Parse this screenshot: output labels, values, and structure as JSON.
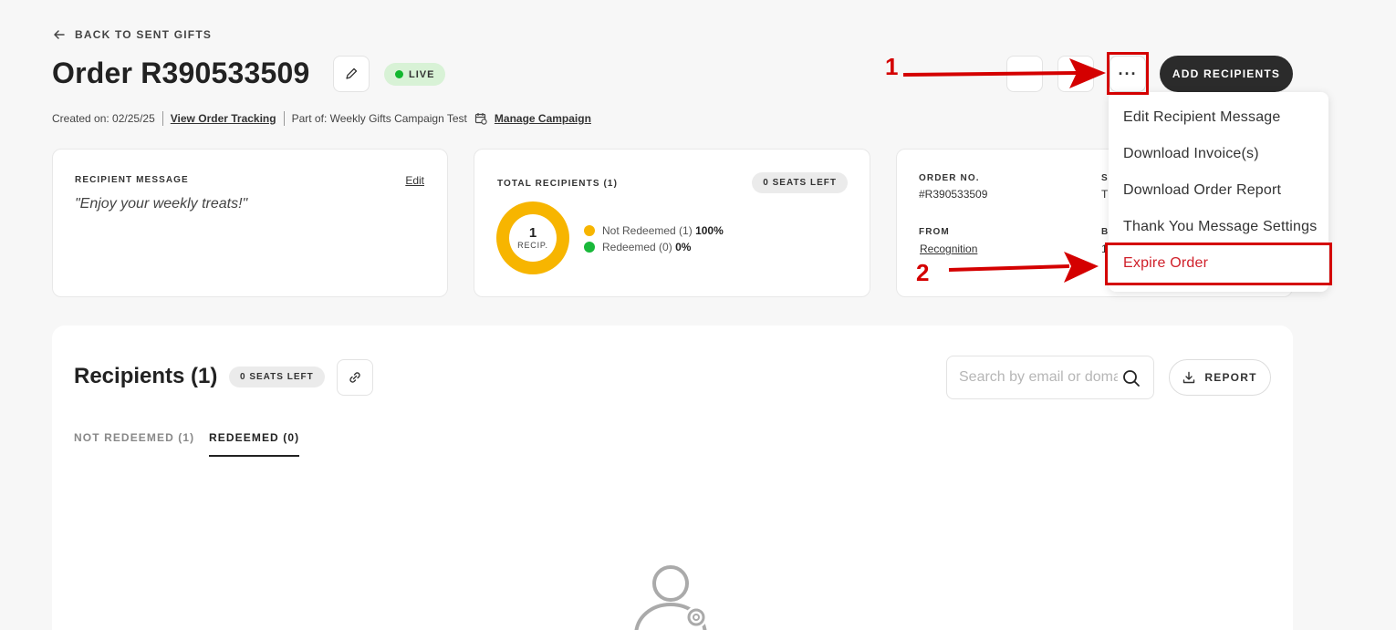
{
  "nav": {
    "back_label": "BACK TO SENT GIFTS"
  },
  "header": {
    "title": "Order R390533509",
    "status": "LIVE",
    "add_label": "ADD RECIPIENTS",
    "more_label": "···"
  },
  "meta": {
    "created": "Created on: 02/25/25",
    "tracking_link": "View Order Tracking",
    "part_of": "Part of: Weekly Gifts Campaign Test",
    "campaign_link": "Manage Campaign"
  },
  "message_card": {
    "label": "RECIPIENT MESSAGE",
    "edit": "Edit",
    "message": "\"Enjoy your weekly treats!\""
  },
  "recipients_card": {
    "label": "TOTAL RECIPIENTS (1)",
    "seats": "0 SEATS LEFT",
    "count": "1",
    "count_label": "RECIP.",
    "legend": [
      {
        "label": "Not Redeemed (1)",
        "pct": "100%",
        "color": "#f7b500"
      },
      {
        "label": "Redeemed (0)",
        "pct": "0%",
        "color": "#19b83a"
      }
    ]
  },
  "order_card": {
    "order_label": "ORDER NO.",
    "order_value": "#R390533509",
    "from_label": "FROM",
    "from_value": "Recognition",
    "col2_label_top": "S",
    "col2_value_top": "T",
    "col2_label_bottom": "B",
    "col2_value_bottom": "1"
  },
  "recipients": {
    "title": "Recipients (1)",
    "seats": "0 SEATS LEFT",
    "search_placeholder": "Search by email or domain",
    "report_label": "REPORT",
    "tabs": [
      "NOT REDEEMED (1)",
      "REDEEMED (0)"
    ]
  },
  "menu": {
    "items": [
      "Edit Recipient Message",
      "Download Invoice(s)",
      "Download Order Report",
      "Thank You Message Settings",
      "Expire Order"
    ]
  },
  "annotations": {
    "step1": "1",
    "step2": "2",
    "color": "#d40000"
  }
}
